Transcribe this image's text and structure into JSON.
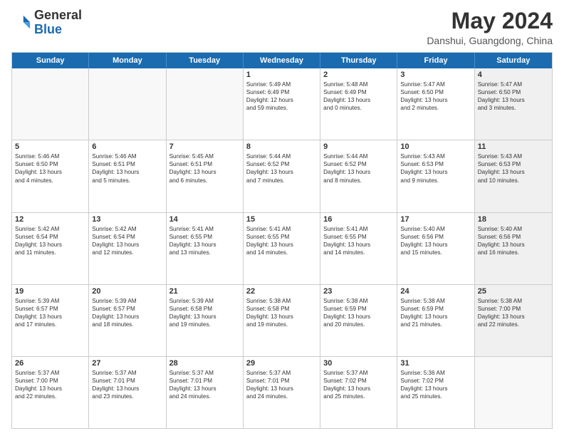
{
  "logo": {
    "line1": "General",
    "line2": "Blue"
  },
  "title": "May 2024",
  "subtitle": "Danshui, Guangdong, China",
  "days_of_week": [
    "Sunday",
    "Monday",
    "Tuesday",
    "Wednesday",
    "Thursday",
    "Friday",
    "Saturday"
  ],
  "weeks": [
    [
      {
        "day": "",
        "lines": [],
        "empty": true
      },
      {
        "day": "",
        "lines": [],
        "empty": true
      },
      {
        "day": "",
        "lines": [],
        "empty": true
      },
      {
        "day": "1",
        "lines": [
          "Sunrise: 5:49 AM",
          "Sunset: 6:49 PM",
          "Daylight: 12 hours",
          "and 59 minutes."
        ]
      },
      {
        "day": "2",
        "lines": [
          "Sunrise: 5:48 AM",
          "Sunset: 6:49 PM",
          "Daylight: 13 hours",
          "and 0 minutes."
        ]
      },
      {
        "day": "3",
        "lines": [
          "Sunrise: 5:47 AM",
          "Sunset: 6:50 PM",
          "Daylight: 13 hours",
          "and 2 minutes."
        ]
      },
      {
        "day": "4",
        "lines": [
          "Sunrise: 5:47 AM",
          "Sunset: 6:50 PM",
          "Daylight: 13 hours",
          "and 3 minutes."
        ],
        "shaded": true
      }
    ],
    [
      {
        "day": "5",
        "lines": [
          "Sunrise: 5:46 AM",
          "Sunset: 6:50 PM",
          "Daylight: 13 hours",
          "and 4 minutes."
        ]
      },
      {
        "day": "6",
        "lines": [
          "Sunrise: 5:46 AM",
          "Sunset: 6:51 PM",
          "Daylight: 13 hours",
          "and 5 minutes."
        ]
      },
      {
        "day": "7",
        "lines": [
          "Sunrise: 5:45 AM",
          "Sunset: 6:51 PM",
          "Daylight: 13 hours",
          "and 6 minutes."
        ]
      },
      {
        "day": "8",
        "lines": [
          "Sunrise: 5:44 AM",
          "Sunset: 6:52 PM",
          "Daylight: 13 hours",
          "and 7 minutes."
        ]
      },
      {
        "day": "9",
        "lines": [
          "Sunrise: 5:44 AM",
          "Sunset: 6:52 PM",
          "Daylight: 13 hours",
          "and 8 minutes."
        ]
      },
      {
        "day": "10",
        "lines": [
          "Sunrise: 5:43 AM",
          "Sunset: 6:53 PM",
          "Daylight: 13 hours",
          "and 9 minutes."
        ]
      },
      {
        "day": "11",
        "lines": [
          "Sunrise: 5:43 AM",
          "Sunset: 6:53 PM",
          "Daylight: 13 hours",
          "and 10 minutes."
        ],
        "shaded": true
      }
    ],
    [
      {
        "day": "12",
        "lines": [
          "Sunrise: 5:42 AM",
          "Sunset: 6:54 PM",
          "Daylight: 13 hours",
          "and 11 minutes."
        ]
      },
      {
        "day": "13",
        "lines": [
          "Sunrise: 5:42 AM",
          "Sunset: 6:54 PM",
          "Daylight: 13 hours",
          "and 12 minutes."
        ]
      },
      {
        "day": "14",
        "lines": [
          "Sunrise: 5:41 AM",
          "Sunset: 6:55 PM",
          "Daylight: 13 hours",
          "and 13 minutes."
        ]
      },
      {
        "day": "15",
        "lines": [
          "Sunrise: 5:41 AM",
          "Sunset: 6:55 PM",
          "Daylight: 13 hours",
          "and 14 minutes."
        ]
      },
      {
        "day": "16",
        "lines": [
          "Sunrise: 5:41 AM",
          "Sunset: 6:55 PM",
          "Daylight: 13 hours",
          "and 14 minutes."
        ]
      },
      {
        "day": "17",
        "lines": [
          "Sunrise: 5:40 AM",
          "Sunset: 6:56 PM",
          "Daylight: 13 hours",
          "and 15 minutes."
        ]
      },
      {
        "day": "18",
        "lines": [
          "Sunrise: 5:40 AM",
          "Sunset: 6:56 PM",
          "Daylight: 13 hours",
          "and 16 minutes."
        ],
        "shaded": true
      }
    ],
    [
      {
        "day": "19",
        "lines": [
          "Sunrise: 5:39 AM",
          "Sunset: 6:57 PM",
          "Daylight: 13 hours",
          "and 17 minutes."
        ]
      },
      {
        "day": "20",
        "lines": [
          "Sunrise: 5:39 AM",
          "Sunset: 6:57 PM",
          "Daylight: 13 hours",
          "and 18 minutes."
        ]
      },
      {
        "day": "21",
        "lines": [
          "Sunrise: 5:39 AM",
          "Sunset: 6:58 PM",
          "Daylight: 13 hours",
          "and 19 minutes."
        ]
      },
      {
        "day": "22",
        "lines": [
          "Sunrise: 5:38 AM",
          "Sunset: 6:58 PM",
          "Daylight: 13 hours",
          "and 19 minutes."
        ]
      },
      {
        "day": "23",
        "lines": [
          "Sunrise: 5:38 AM",
          "Sunset: 6:59 PM",
          "Daylight: 13 hours",
          "and 20 minutes."
        ]
      },
      {
        "day": "24",
        "lines": [
          "Sunrise: 5:38 AM",
          "Sunset: 6:59 PM",
          "Daylight: 13 hours",
          "and 21 minutes."
        ]
      },
      {
        "day": "25",
        "lines": [
          "Sunrise: 5:38 AM",
          "Sunset: 7:00 PM",
          "Daylight: 13 hours",
          "and 22 minutes."
        ],
        "shaded": true
      }
    ],
    [
      {
        "day": "26",
        "lines": [
          "Sunrise: 5:37 AM",
          "Sunset: 7:00 PM",
          "Daylight: 13 hours",
          "and 22 minutes."
        ]
      },
      {
        "day": "27",
        "lines": [
          "Sunrise: 5:37 AM",
          "Sunset: 7:01 PM",
          "Daylight: 13 hours",
          "and 23 minutes."
        ]
      },
      {
        "day": "28",
        "lines": [
          "Sunrise: 5:37 AM",
          "Sunset: 7:01 PM",
          "Daylight: 13 hours",
          "and 24 minutes."
        ]
      },
      {
        "day": "29",
        "lines": [
          "Sunrise: 5:37 AM",
          "Sunset: 7:01 PM",
          "Daylight: 13 hours",
          "and 24 minutes."
        ]
      },
      {
        "day": "30",
        "lines": [
          "Sunrise: 5:37 AM",
          "Sunset: 7:02 PM",
          "Daylight: 13 hours",
          "and 25 minutes."
        ]
      },
      {
        "day": "31",
        "lines": [
          "Sunrise: 5:36 AM",
          "Sunset: 7:02 PM",
          "Daylight: 13 hours",
          "and 25 minutes."
        ]
      },
      {
        "day": "",
        "lines": [],
        "empty": true,
        "shaded": true
      }
    ]
  ]
}
